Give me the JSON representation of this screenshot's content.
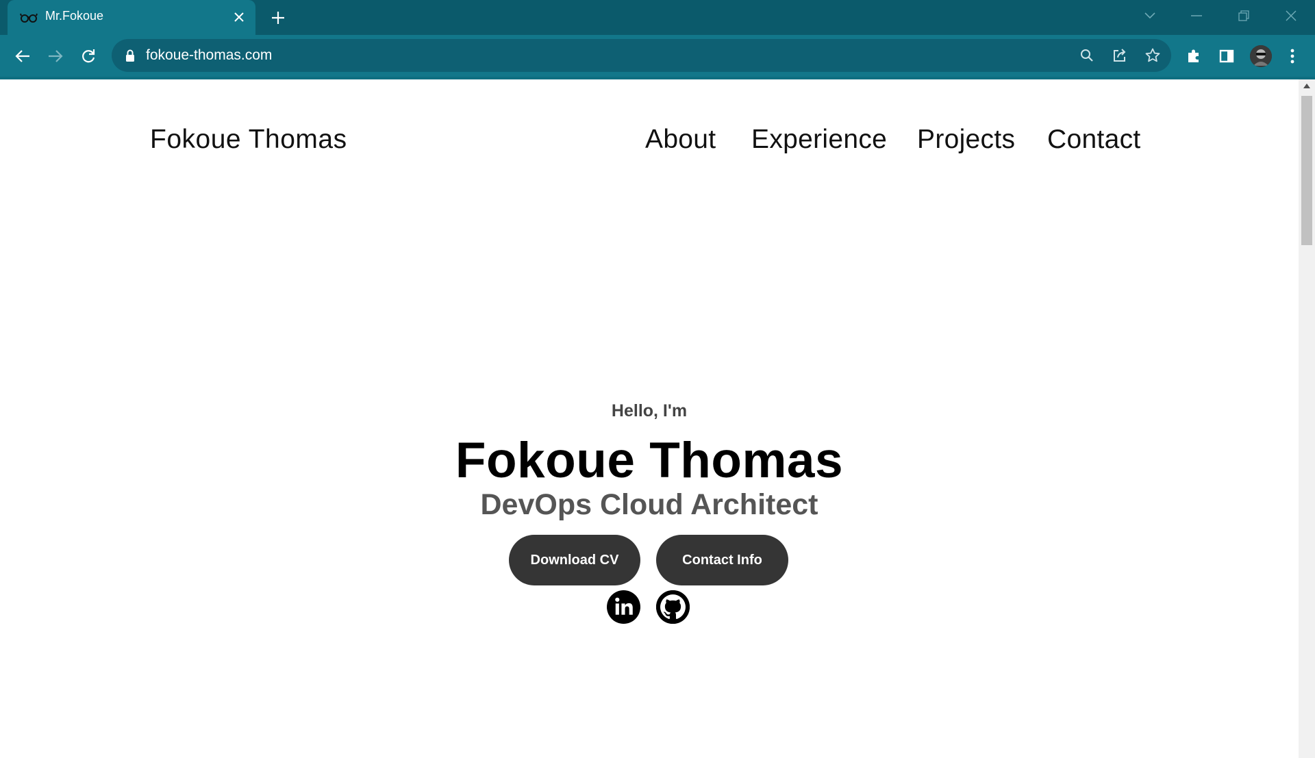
{
  "browser": {
    "tab_title": "Mr.Fokoue",
    "url": "fokoue-thomas.com"
  },
  "site": {
    "brand": "Fokoue Thomas",
    "nav": [
      "About",
      "Experience",
      "Projects",
      "Contact"
    ]
  },
  "hero": {
    "greeting": "Hello, I'm",
    "name": "Fokoue Thomas",
    "title": "DevOps Cloud Architect",
    "buttons": [
      "Download CV",
      "Contact Info"
    ],
    "social": [
      "linkedin-icon",
      "github-icon"
    ]
  },
  "colors": {
    "chrome_dark": "#0b5a6b",
    "chrome_toolbar": "#12778a",
    "button_bg": "#353535"
  }
}
